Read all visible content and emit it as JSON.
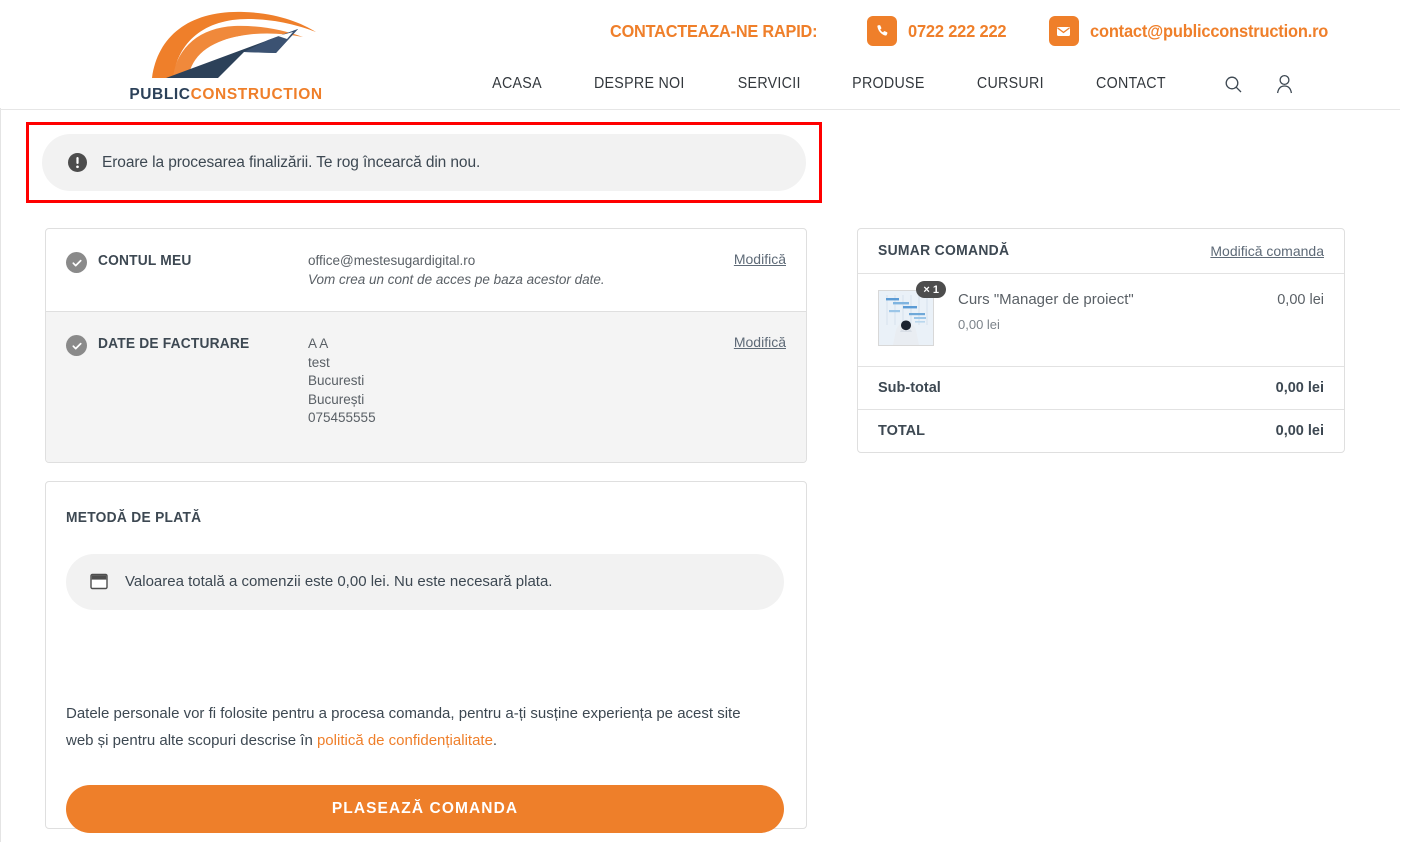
{
  "brand": {
    "logo_text_dark": "PUBLIC",
    "logo_text_orange": "CONSTRUCTION",
    "accent_color": "#ee7f2a",
    "dark_color": "#2c4159"
  },
  "header": {
    "contact_label": "CONTACTEAZA-NE RAPID:",
    "phone": "0722 222 222",
    "email": "contact@publicconstruction.ro",
    "phone_icon": "phone-icon",
    "mail_icon": "mail-icon",
    "nav": [
      {
        "label": "ACASA"
      },
      {
        "label": "DESPRE NOI"
      },
      {
        "label": "SERVICII"
      },
      {
        "label": "PRODUSE"
      },
      {
        "label": "CURSURI"
      },
      {
        "label": "CONTACT"
      }
    ],
    "search_icon": "search-icon",
    "account_icon": "user-account-icon"
  },
  "error": {
    "icon": "exclamation-circle-icon",
    "message": "Eroare la procesarea finalizării. Te rog încearcă din nou.",
    "highlight_color": "#ff0000"
  },
  "account": {
    "title": "CONTUL MEU",
    "email": "office@mestesugardigital.ro",
    "note": "Vom crea un cont de acces pe baza acestor date.",
    "edit_label": "Modifică"
  },
  "billing": {
    "title": "DATE DE FACTURARE",
    "lines": [
      "A A",
      "test",
      "Bucuresti",
      "București",
      "075455555"
    ],
    "edit_label": "Modifică"
  },
  "payment": {
    "title": "METODĂ DE PLATĂ",
    "icon": "card-icon",
    "note": "Valoarea totală a comenzii este 0,00 lei. Nu este necesară plata.",
    "privacy_text_before": "Datele personale vor fi folosite pentru a procesa comanda, pentru a-ți susține experiența pe acest site web și pentru alte scopuri descrise în ",
    "privacy_link": "politică de confidențialitate",
    "privacy_text_after": ".",
    "submit_label": "PLASEAZĂ COMANDA"
  },
  "summary": {
    "title": "SUMAR COMANDĂ",
    "edit_label": "Modifică comanda",
    "items": [
      {
        "name": "Curs \"Manager de proiect\"",
        "unit_price": "0,00 lei",
        "line_total": "0,00 lei",
        "quantity_badge": "× 1",
        "thumbnail": "course-project-manager-thumbnail"
      }
    ],
    "subtotal_label": "Sub-total",
    "subtotal_value": "0,00 lei",
    "total_label": "TOTAL",
    "total_value": "0,00 lei"
  }
}
